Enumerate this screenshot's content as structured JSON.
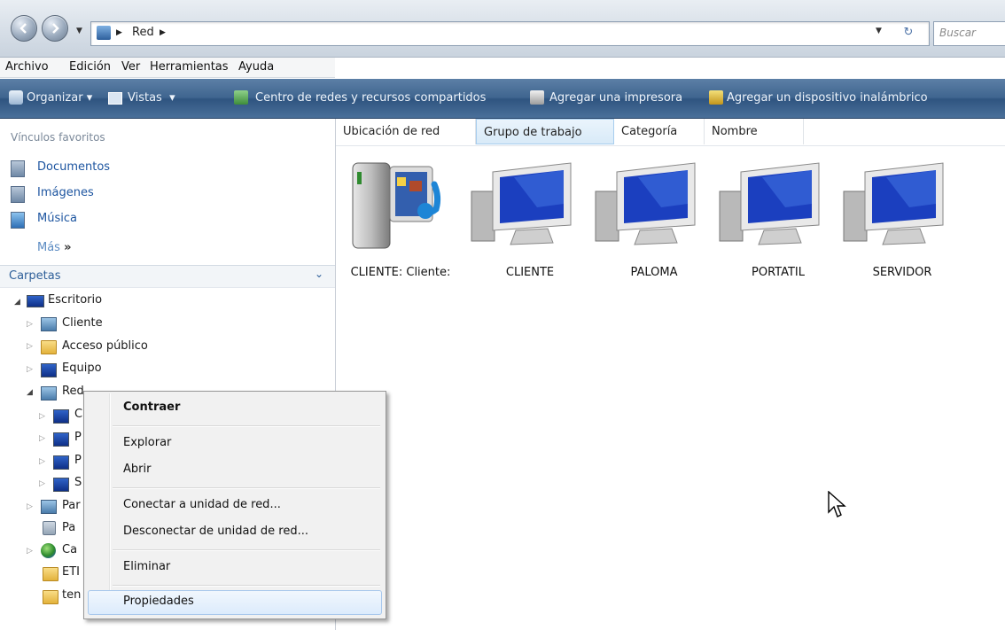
{
  "address": {
    "path": [
      "Red"
    ],
    "search_placeholder": "Buscar"
  },
  "menubar": [
    "Archivo",
    "Edición",
    "Ver",
    "Herramientas",
    "Ayuda"
  ],
  "toolbar": {
    "organize": "Organizar",
    "views": "Vistas",
    "network_center": "Centro de redes y recursos compartidos",
    "add_printer": "Agregar una impresora",
    "add_wireless": "Agregar un dispositivo inalámbrico"
  },
  "favorites": {
    "header": "Vínculos favoritos",
    "items": [
      "Documentos",
      "Imágenes",
      "Música"
    ],
    "more": "Más"
  },
  "folders": {
    "header": "Carpetas",
    "tree": [
      "Escritorio",
      "Cliente",
      "Acceso público",
      "Equipo",
      "Red",
      "C",
      "P",
      "P",
      "S",
      "Par",
      "Pa",
      "Ca",
      "ETI",
      "ten"
    ]
  },
  "columns": [
    "Ubicación de red",
    "Grupo de trabajo",
    "Categoría",
    "Nombre"
  ],
  "items": [
    "CLIENTE: Cliente:",
    "CLIENTE",
    "PALOMA",
    "PORTATIL",
    "SERVIDOR"
  ],
  "context_menu": {
    "collapse": "Contraer",
    "explore": "Explorar",
    "open": "Abrir",
    "map_drive": "Conectar a unidad de red...",
    "disconnect_drive": "Desconectar de unidad de red...",
    "delete": "Eliminar",
    "properties": "Propiedades"
  }
}
